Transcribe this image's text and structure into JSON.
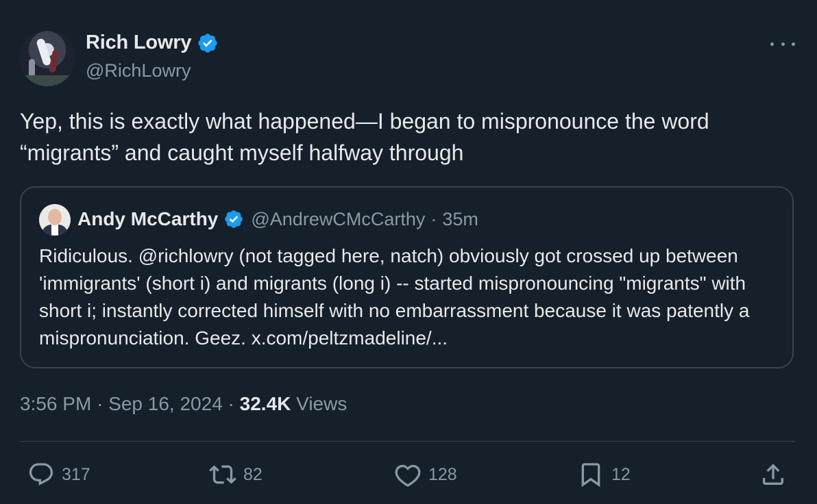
{
  "author": {
    "display_name": "Rich Lowry",
    "handle": "@RichLowry",
    "verified": true
  },
  "tweet": {
    "text": "Yep, this is exactly what happened—I began to mispronounce the word “migrants” and caught myself halfway through"
  },
  "quoted": {
    "display_name": "Andy McCarthy",
    "handle": "@AndrewCMcCarthy",
    "separator": "·",
    "age": "35m",
    "text": "Ridiculous. @richlowry (not tagged here, natch) obviously got crossed up between 'immigrants' (short i) and migrants (long i) -- started mispronouncing \"migrants\" with short i; instantly corrected himself with no embarrassment because it was patently a mispronunciation. Geez. x.com/peltzmadeline/..."
  },
  "meta": {
    "time": "3:56 PM",
    "sep1": "·",
    "date": "Sep 16, 2024",
    "sep2": "·",
    "views_count": "32.4K",
    "views_label": "Views"
  },
  "actions": {
    "replies": "317",
    "reposts": "82",
    "likes": "128",
    "bookmarks": "12"
  },
  "colors": {
    "background": "#15202b",
    "text": "#e7e9ea",
    "secondary": "#8b98a5",
    "border": "#38444d",
    "verified": "#1d9bf0"
  },
  "icons": {
    "verified": "verified-badge-icon",
    "more": "more-horizontal-icon",
    "reply": "reply-icon",
    "repost": "repost-icon",
    "like": "heart-icon",
    "bookmark": "bookmark-icon",
    "share": "share-icon"
  }
}
